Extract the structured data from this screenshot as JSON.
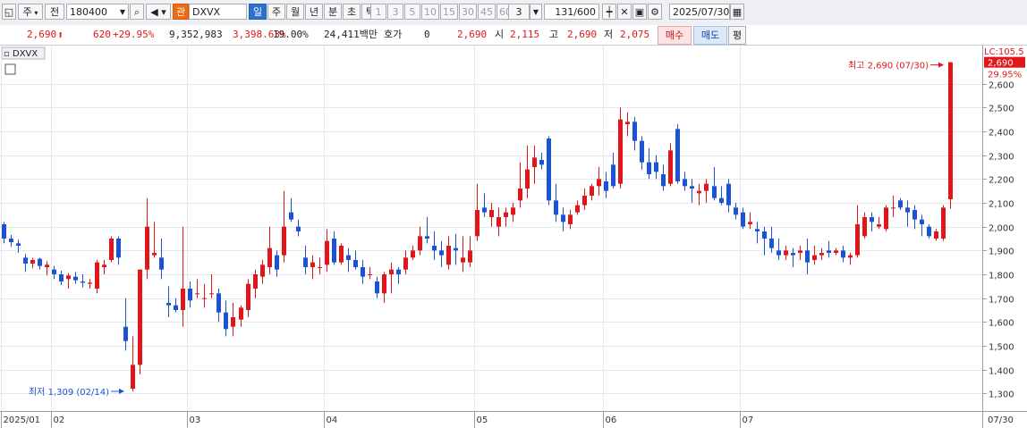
{
  "toolbar": {
    "period_select": "주",
    "prev_btn": "전",
    "code": "180400",
    "market_badge": "관",
    "name": "DXVX",
    "periods": [
      "일",
      "주",
      "월",
      "년",
      "분",
      "초",
      "틱"
    ],
    "active_period": "일",
    "nums": [
      "1",
      "3",
      "5",
      "10",
      "15",
      "30",
      "45",
      "60"
    ],
    "num_sel": "3",
    "count": "131",
    "count_total": "/600",
    "date": "2025/07/30"
  },
  "quote": {
    "price": "2,690",
    "change": "620",
    "change_pct": "+29.95%",
    "volume": "9,352,983",
    "volume_pct": "3,398.63%",
    "turnover": "19.00%",
    "amount": "24,411백만",
    "hoga_label": "호가",
    "hoga_value": "0",
    "hoga_price": "2,690",
    "open_label": "시",
    "open": "2,115",
    "high_label": "고",
    "high": "2,690",
    "low_label": "저",
    "low": "2,075",
    "buy": "매수",
    "sell": "매도",
    "avg": "평"
  },
  "chart_data": {
    "type": "candlestick",
    "title": "DXVX",
    "ylim": [
      1230,
      2760
    ],
    "y_ticks": [
      "1,300",
      "1,400",
      "1,500",
      "1,600",
      "1,700",
      "1,800",
      "1,900",
      "2,000",
      "2,100",
      "2,200",
      "2,300",
      "2,400",
      "2,500",
      "2,600"
    ],
    "x_labels": [
      "2025/01",
      "02",
      "03",
      "04",
      "05",
      "06",
      "07"
    ],
    "x_label_days": [
      0,
      7,
      26,
      45,
      66,
      84,
      103
    ],
    "last_date": "07/30",
    "scale_label": "LC:105.5",
    "price_tag": "2,690",
    "pct_tag": "29.95%",
    "up_color": "#e0161b",
    "down_color": "#1a53d6",
    "high_note": "최고 2,690 (07/30)",
    "low_note": "최저 1,309 (02/14)",
    "candles": [
      [
        2010,
        2020,
        1930,
        1950
      ],
      [
        1950,
        1965,
        1915,
        1935
      ],
      [
        1930,
        1945,
        1890,
        1920
      ],
      [
        1870,
        1885,
        1810,
        1845
      ],
      [
        1845,
        1870,
        1825,
        1860
      ],
      [
        1865,
        1870,
        1820,
        1835
      ],
      [
        1830,
        1855,
        1795,
        1840
      ],
      [
        1820,
        1835,
        1780,
        1800
      ],
      [
        1800,
        1815,
        1755,
        1770
      ],
      [
        1780,
        1805,
        1740,
        1795
      ],
      [
        1790,
        1810,
        1760,
        1775
      ],
      [
        1770,
        1800,
        1745,
        1765
      ],
      [
        1760,
        1780,
        1740,
        1765
      ],
      [
        1740,
        1860,
        1720,
        1850
      ],
      [
        1830,
        1860,
        1800,
        1840
      ],
      [
        1860,
        1960,
        1850,
        1950
      ],
      [
        1950,
        1960,
        1840,
        1870
      ],
      [
        1580,
        1700,
        1480,
        1520
      ],
      [
        1320,
        1540,
        1309,
        1420
      ],
      [
        1420,
        1820,
        1380,
        1820
      ],
      [
        1820,
        2120,
        1780,
        2000
      ],
      [
        1880,
        2020,
        1870,
        1890
      ],
      [
        1870,
        1950,
        1780,
        1820
      ],
      [
        1680,
        1750,
        1620,
        1670
      ],
      [
        1670,
        1700,
        1640,
        1650
      ],
      [
        1650,
        2000,
        1580,
        1740
      ],
      [
        1740,
        1770,
        1660,
        1690
      ],
      [
        1720,
        1780,
        1700,
        1720
      ],
      [
        1700,
        1760,
        1660,
        1700
      ],
      [
        1720,
        1800,
        1700,
        1720
      ],
      [
        1720,
        1740,
        1600,
        1640
      ],
      [
        1640,
        1690,
        1540,
        1570
      ],
      [
        1580,
        1680,
        1540,
        1620
      ],
      [
        1610,
        1670,
        1580,
        1660
      ],
      [
        1650,
        1780,
        1620,
        1760
      ],
      [
        1740,
        1820,
        1700,
        1800
      ],
      [
        1790,
        1860,
        1760,
        1840
      ],
      [
        1830,
        2000,
        1800,
        1910
      ],
      [
        1880,
        1900,
        1790,
        1820
      ],
      [
        1880,
        2150,
        1850,
        2000
      ],
      [
        2060,
        2120,
        2020,
        2030
      ],
      [
        2000,
        2030,
        1960,
        1980
      ],
      [
        1870,
        1920,
        1800,
        1830
      ],
      [
        1830,
        1880,
        1780,
        1850
      ],
      [
        1830,
        1870,
        1800,
        1830
      ],
      [
        1840,
        1990,
        1810,
        1940
      ],
      [
        1950,
        1980,
        1840,
        1850
      ],
      [
        1850,
        1930,
        1840,
        1920
      ],
      [
        1880,
        1910,
        1810,
        1860
      ],
      [
        1860,
        1900,
        1820,
        1830
      ],
      [
        1830,
        1860,
        1760,
        1790
      ],
      [
        1800,
        1830,
        1780,
        1800
      ],
      [
        1770,
        1790,
        1700,
        1720
      ],
      [
        1720,
        1810,
        1680,
        1800
      ],
      [
        1800,
        1850,
        1720,
        1820
      ],
      [
        1820,
        1830,
        1760,
        1800
      ],
      [
        1820,
        1900,
        1800,
        1870
      ],
      [
        1870,
        1920,
        1860,
        1900
      ],
      [
        1900,
        2000,
        1880,
        1960
      ],
      [
        1960,
        2040,
        1930,
        1950
      ],
      [
        1920,
        1980,
        1860,
        1900
      ],
      [
        1900,
        1940,
        1830,
        1880
      ],
      [
        1840,
        1960,
        1820,
        1920
      ],
      [
        1910,
        1970,
        1840,
        1900
      ],
      [
        1850,
        1960,
        1810,
        1870
      ],
      [
        1850,
        1960,
        1830,
        1900
      ],
      [
        1960,
        2180,
        1940,
        2070
      ],
      [
        2080,
        2140,
        2040,
        2060
      ],
      [
        2040,
        2100,
        2000,
        2070
      ],
      [
        2000,
        2080,
        1960,
        2040
      ],
      [
        2040,
        2080,
        2000,
        2060
      ],
      [
        2050,
        2100,
        2020,
        2080
      ],
      [
        2110,
        2270,
        2080,
        2160
      ],
      [
        2160,
        2340,
        2120,
        2240
      ],
      [
        2250,
        2340,
        2180,
        2290
      ],
      [
        2280,
        2310,
        2240,
        2260
      ],
      [
        2370,
        2380,
        2090,
        2110
      ],
      [
        2110,
        2180,
        2020,
        2050
      ],
      [
        2050,
        2080,
        1980,
        2020
      ],
      [
        2010,
        2070,
        1990,
        2050
      ],
      [
        2060,
        2110,
        2050,
        2090
      ],
      [
        2090,
        2160,
        2070,
        2130
      ],
      [
        2130,
        2180,
        2110,
        2170
      ],
      [
        2170,
        2250,
        2130,
        2200
      ],
      [
        2190,
        2230,
        2120,
        2150
      ],
      [
        2260,
        2310,
        2160,
        2170
      ],
      [
        2180,
        2500,
        2160,
        2450
      ],
      [
        2430,
        2480,
        2380,
        2440
      ],
      [
        2440,
        2460,
        2320,
        2360
      ],
      [
        2360,
        2380,
        2240,
        2270
      ],
      [
        2270,
        2330,
        2200,
        2220
      ],
      [
        2270,
        2300,
        2200,
        2230
      ],
      [
        2220,
        2260,
        2150,
        2170
      ],
      [
        2180,
        2350,
        2170,
        2320
      ],
      [
        2410,
        2430,
        2180,
        2190
      ],
      [
        2200,
        2230,
        2150,
        2170
      ],
      [
        2170,
        2200,
        2100,
        2160
      ],
      [
        2140,
        2180,
        2090,
        2150
      ],
      [
        2150,
        2200,
        2100,
        2180
      ],
      [
        2170,
        2250,
        2110,
        2120
      ],
      [
        2120,
        2170,
        2090,
        2100
      ],
      [
        2180,
        2200,
        2060,
        2090
      ],
      [
        2080,
        2100,
        2030,
        2050
      ],
      [
        2060,
        2080,
        1990,
        2000
      ],
      [
        2010,
        2060,
        1990,
        2020
      ],
      [
        1990,
        2020,
        1930,
        1980
      ],
      [
        1980,
        2000,
        1880,
        1950
      ],
      [
        1950,
        2000,
        1890,
        1910
      ],
      [
        1900,
        1950,
        1860,
        1880
      ],
      [
        1880,
        1920,
        1860,
        1900
      ],
      [
        1890,
        1910,
        1830,
        1880
      ],
      [
        1890,
        1920,
        1860,
        1900
      ],
      [
        1900,
        1950,
        1800,
        1850
      ],
      [
        1860,
        1920,
        1840,
        1880
      ],
      [
        1880,
        1910,
        1860,
        1890
      ],
      [
        1900,
        1940,
        1870,
        1890
      ],
      [
        1890,
        1910,
        1880,
        1900
      ],
      [
        1900,
        1920,
        1850,
        1870
      ],
      [
        1870,
        1890,
        1840,
        1880
      ],
      [
        1880,
        2090,
        1870,
        2010
      ],
      [
        1960,
        2060,
        1950,
        2040
      ],
      [
        2040,
        2060,
        1980,
        2020
      ],
      [
        2000,
        2040,
        1990,
        2010
      ],
      [
        1990,
        2090,
        1980,
        2080
      ],
      [
        2080,
        2130,
        2040,
        2080
      ],
      [
        2110,
        2120,
        2070,
        2080
      ],
      [
        2080,
        2110,
        2000,
        2060
      ],
      [
        2070,
        2090,
        1990,
        2030
      ],
      [
        2030,
        2050,
        1960,
        2010
      ],
      [
        2000,
        2010,
        1950,
        1960
      ],
      [
        1950,
        1990,
        1940,
        1980
      ],
      [
        1950,
        2090,
        1940,
        2080
      ],
      [
        2115,
        2690,
        2075,
        2690
      ]
    ]
  }
}
